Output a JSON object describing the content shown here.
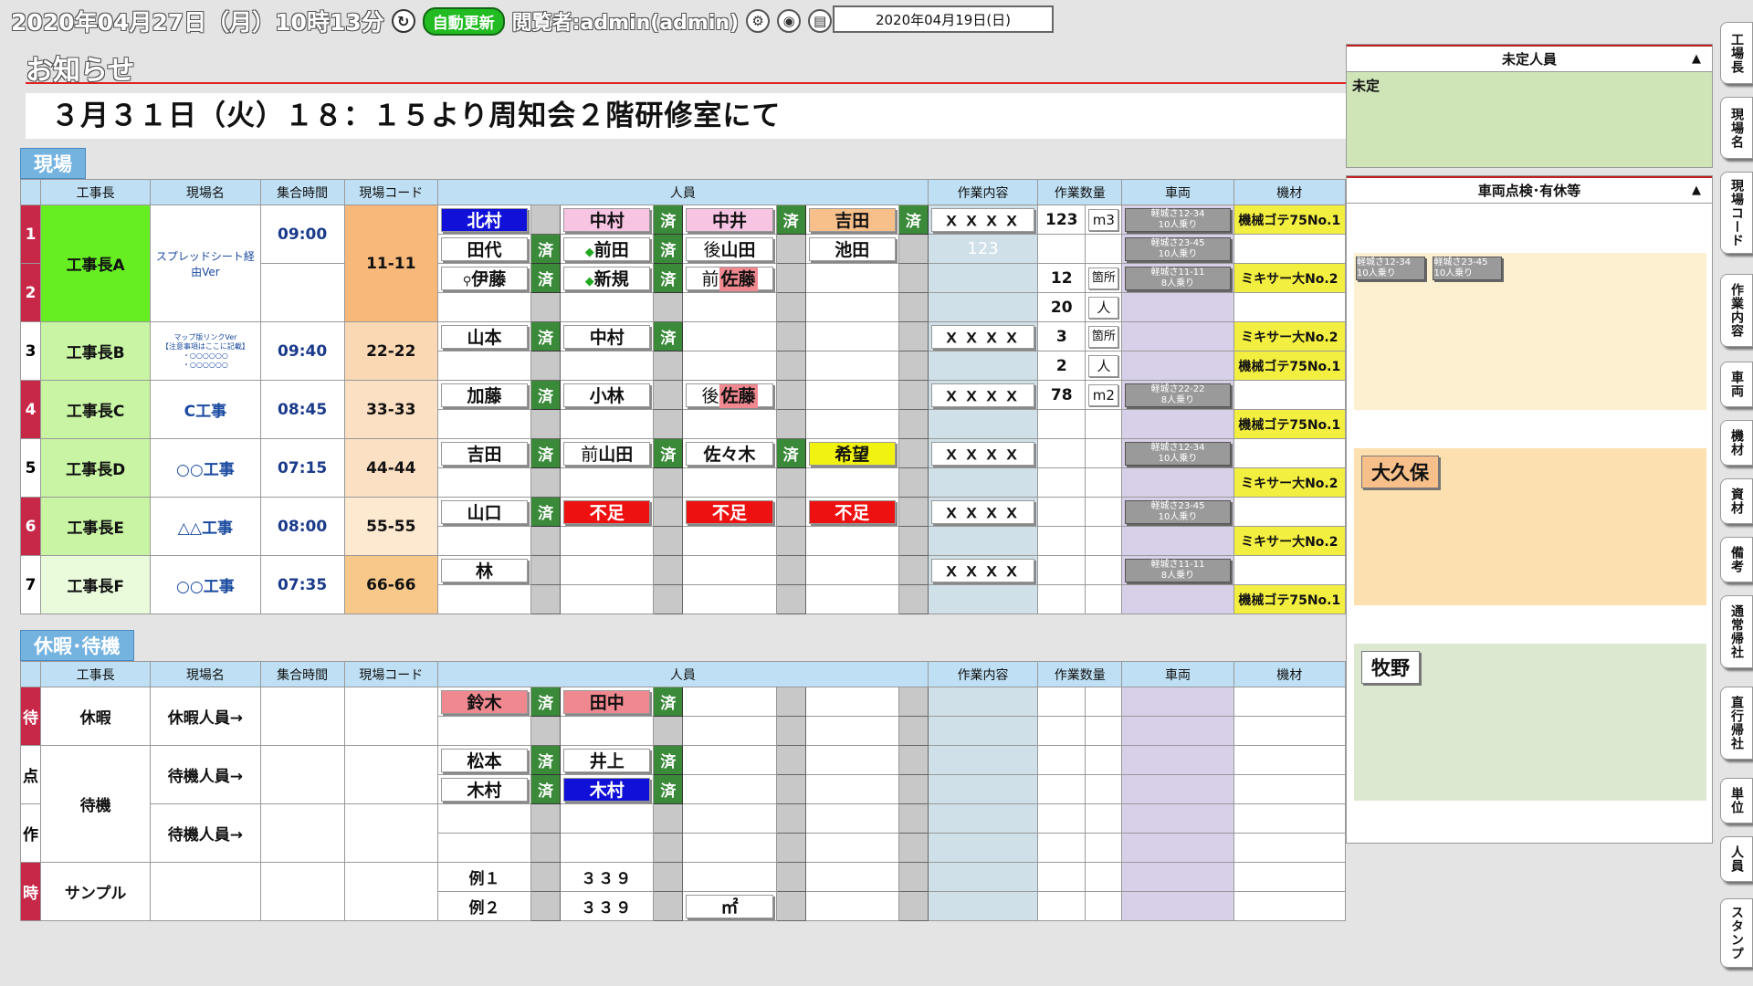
{
  "header": {
    "datetime": "2020年04月27日（月）10時13分",
    "refresh_icon": "refresh-icon",
    "auto_update": "自動更新",
    "viewer": "閲覧者:admin(admin)",
    "gear_icon": "gear-icon",
    "camera_icon": "camera-icon",
    "print_icon": "print-icon",
    "selected_date": "2020年04月19日(日)"
  },
  "notice": {
    "title": "お知らせ",
    "message": "３月３１日（火）１８：１５より周知会２階研修室にて"
  },
  "sections": {
    "genba": "現場",
    "kyuka": "休暇･待機"
  },
  "columns": {
    "boss": "工事長",
    "site": "現場名",
    "time": "集合時間",
    "code": "現場コード",
    "staff": "人員",
    "work": "作業内容",
    "qty": "作業数量",
    "vehicle": "車両",
    "equip": "機材"
  },
  "done": "済",
  "sites": {
    "r1": {
      "num1": "1",
      "num2": "2",
      "boss": "工事長A",
      "site": "スプレッドシート経由Ver",
      "time": "09:00",
      "code": "11-11"
    },
    "r3": {
      "num": "3",
      "boss": "工事長B",
      "site_l1": "マップ版リンクVer",
      "site_l2": "【注意事項はここに記載】",
      "site_l3": "・○○○○○○",
      "site_l4": "・○○○○○○",
      "time": "09:40",
      "code": "22-22"
    },
    "r4": {
      "num": "4",
      "boss": "工事長C",
      "site": "C工事",
      "time": "08:45",
      "code": "33-33"
    },
    "r5": {
      "num": "5",
      "boss": "工事長D",
      "site": "○○工事",
      "time": "07:15",
      "code": "44-44"
    },
    "r6": {
      "num": "6",
      "boss": "工事長E",
      "site": "△△工事",
      "time": "08:00",
      "code": "55-55"
    },
    "r7": {
      "num": "7",
      "boss": "工事長F",
      "site": "○○工事",
      "time": "07:35",
      "code": "66-66"
    }
  },
  "staff": {
    "kitamura": "北村",
    "nakamura": "中村",
    "nakai": "中井",
    "yoshida": "吉田",
    "tashiro": "田代",
    "maeda": "前田",
    "ushiro": "後",
    "yamada": "山田",
    "ikeda": "池田",
    "ito": "伊藤",
    "shinki": "新規",
    "mae": "前",
    "sato": "佐藤",
    "yamamoto": "山本",
    "nakamura2": "中村",
    "kato": "加藤",
    "kobayashi": "小林",
    "ushiro2": "後",
    "sato2": "佐藤",
    "yoshida2": "吉田",
    "mae2": "前",
    "yamada2": "山田",
    "sasaki": "佐々木",
    "kibou": "希望",
    "yamaguchi": "山口",
    "fusoku": "不足",
    "hayashi": "林",
    "suzuki": "鈴木",
    "tanaka": "田中",
    "matsumoto": "松本",
    "inoue": "井上",
    "kimura": "木村",
    "kimura2": "木村",
    "rei1": "例１",
    "rei2": "例２",
    "v339": "３３９",
    "m2": "㎡"
  },
  "bike_icon": "bicycle-icon",
  "beginner_icon": "beginner-mark-icon",
  "work": {
    "xxxx": "ｘｘｘｘ",
    "w123": "123"
  },
  "qty": {
    "q123": "123",
    "u_m3": "m3",
    "q12": "12",
    "u_kasho": "箇所",
    "q20": "20",
    "u_nin": "人",
    "q3": "3",
    "q2": "2",
    "q78": "78",
    "u_m2": "m2"
  },
  "vehicles": {
    "v1": "軽城さ12-34",
    "v1s": "10人乗り",
    "v2": "軽城さ23-45",
    "v2s": "10人乗り",
    "v3": "軽城さ11-11",
    "v3s": "8人乗り",
    "v4": "軽城さ22-22",
    "v4s": "8人乗り",
    "v5": "軽城さ12-34",
    "v5s": "10人乗り",
    "v6": "軽城さ23-45",
    "v6s": "10人乗り",
    "v7": "軽城さ11-11",
    "v7s": "8人乗り"
  },
  "equip": {
    "gote": "機械ゴテ75No.1",
    "mixer": "ミキサー大No.2"
  },
  "leave": {
    "r1": {
      "mark": "待",
      "boss": "休暇",
      "site": "休暇人員→"
    },
    "r2": {
      "mark": "点",
      "boss": "待機",
      "site": "待機人員→"
    },
    "r3": {
      "mark": "作",
      "site": "待機人員→"
    },
    "r4": {
      "mark": "時",
      "boss": "サンプル"
    }
  },
  "right": {
    "mitei_title": "未定人員",
    "mitei_text": "未定",
    "collapse": "▲",
    "check_title": "車両点検･有休等",
    "cards": {
      "v1": "軽城さ12-34",
      "v1s": "10人乗り",
      "v2": "軽城さ23-45",
      "v2s": "10人乗り",
      "okubo": "大久保",
      "makino": "牧野"
    }
  },
  "tabs": [
    "工場長",
    "現場名",
    "現場コード",
    "作業内容",
    "車両",
    "機材",
    "資材",
    "備考",
    "通常帰社",
    "直行帰社",
    "単位",
    "人員",
    "スタンプ"
  ],
  "colors": {
    "accent_red": "#c82848",
    "section_blue": "#74b3e0",
    "done_green": "#3a8a3a",
    "boss_green": "#66ee22",
    "code_orange": "#f7b87a"
  }
}
